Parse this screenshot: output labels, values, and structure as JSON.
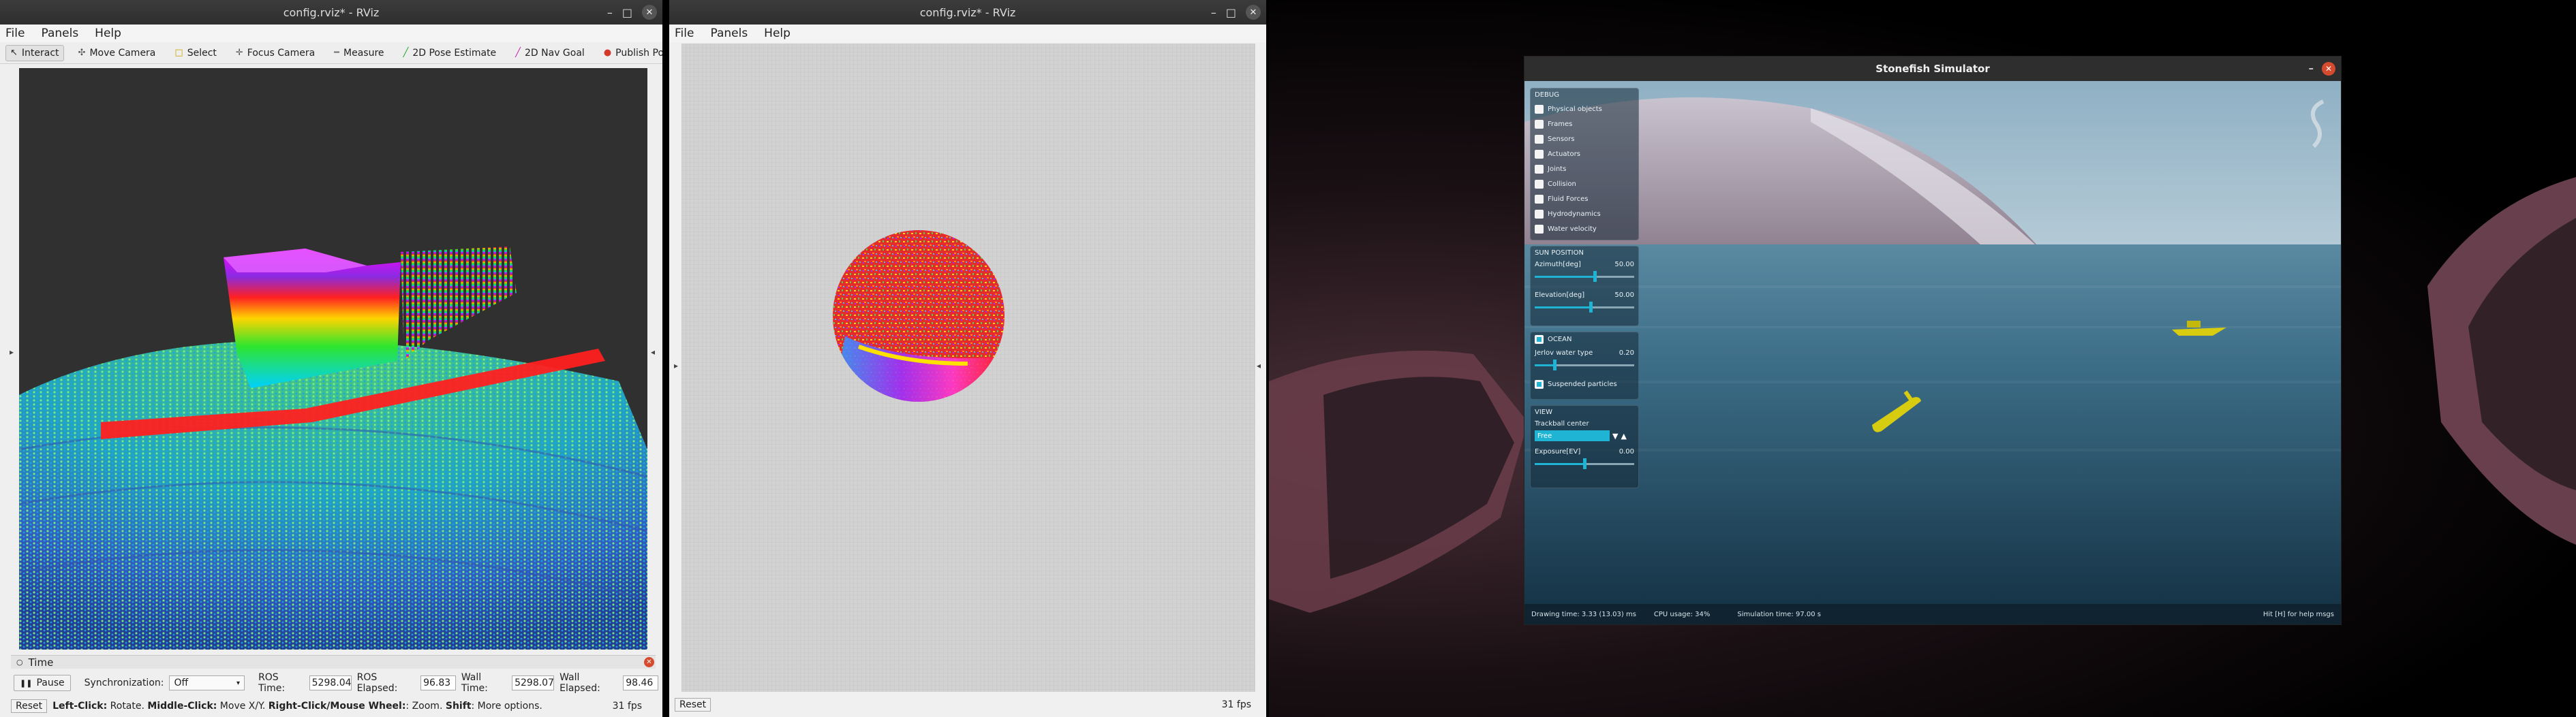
{
  "rviz1": {
    "title": "config.rviz* - RViz",
    "menu": [
      "File",
      "Panels",
      "Help"
    ],
    "tools": [
      {
        "label": "Interact",
        "icon": "cursor-icon",
        "icon_glyph": "↖",
        "icon_color": "#333333",
        "active": true
      },
      {
        "label": "Move Camera",
        "icon": "move-camera-icon",
        "icon_glyph": "✣",
        "icon_color": "#555555",
        "active": false
      },
      {
        "label": "Select",
        "icon": "select-icon",
        "icon_glyph": "□",
        "icon_color": "#c9a400",
        "active": false
      },
      {
        "label": "Focus Camera",
        "icon": "focus-camera-icon",
        "icon_glyph": "✛",
        "icon_color": "#555555",
        "active": false
      },
      {
        "label": "Measure",
        "icon": "ruler-icon",
        "icon_glyph": "━",
        "icon_color": "#777777",
        "active": false
      },
      {
        "label": "2D Pose Estimate",
        "icon": "pose-estimate-icon",
        "icon_glyph": "╱",
        "icon_color": "#2aa52a",
        "active": false
      },
      {
        "label": "2D Nav Goal",
        "icon": "nav-goal-icon",
        "icon_glyph": "╱",
        "icon_color": "#cc22aa",
        "active": false
      },
      {
        "label": "Publish Point",
        "icon": "map-pin-icon",
        "icon_glyph": "●",
        "icon_color": "#d33a2a",
        "active": false
      }
    ],
    "toolbar_extra": {
      "add": "+",
      "remove": "−",
      "more": "»"
    },
    "time_panel": {
      "header": "Time",
      "pause_label": "Pause",
      "sync_label": "Synchronization:",
      "sync_value": "Off",
      "ros_time_label": "ROS Time:",
      "ros_time_value": "5298.04",
      "ros_elapsed_label": "ROS Elapsed:",
      "ros_elapsed_value": "96.83",
      "wall_time_label": "Wall Time:",
      "wall_time_value": "5298.07",
      "wall_elapsed_label": "Wall Elapsed:",
      "wall_elapsed_value": "98.46"
    },
    "status": {
      "reset": "Reset",
      "left_key": "Left-Click:",
      "left_text": " Rotate. ",
      "middle_key": "Middle-Click:",
      "middle_text": " Move X/Y. ",
      "right_key": "Right-Click/Mouse Wheel:",
      "right_text": ": Zoom. ",
      "shift_key": "Shift",
      "shift_text": ": More options.",
      "fps": "31 fps"
    }
  },
  "rviz2": {
    "title": "config.rviz* - RViz",
    "menu": [
      "File",
      "Panels",
      "Help"
    ],
    "status": {
      "reset": "Reset",
      "fps": "31 fps"
    }
  },
  "stonefish": {
    "title": "Stonefish Simulator",
    "debug": {
      "header": "DEBUG",
      "items": [
        "Physical objects",
        "Frames",
        "Sensors",
        "Actuators",
        "Joints",
        "Collision",
        "Fluid Forces",
        "Hydrodynamics",
        "Water velocity"
      ]
    },
    "sun": {
      "header": "SUN POSITION",
      "azimuth_label": "Azimuth[deg]",
      "azimuth_value": "50.00",
      "azimuth_level": 0.6,
      "elevation_label": "Elevation[deg]",
      "elevation_value": "50.00",
      "elevation_level": 0.56
    },
    "ocean": {
      "header": "OCEAN",
      "checked": true,
      "water_label": "Jerlov water type",
      "water_value": "0.20",
      "water_level": 0.2,
      "particles_label": "Suspended particles",
      "particles_checked": true
    },
    "view": {
      "header": "VIEW",
      "trackball_label": "Trackball center",
      "trackball_value": "Free",
      "exposure_label": "Exposure[EV]",
      "exposure_value": "0.00",
      "exposure_level": 0.5
    },
    "status": {
      "drawing": "Drawing time: 3.33 (13.03) ms",
      "cpu": "CPU usage: 34%",
      "sim_time": "Simulation time: 97.00 s",
      "hint": "Hit [H] for help msgs"
    }
  },
  "colors": {
    "accent_cyan": "#1fb4d3",
    "ocean_dark": "#1b3a4d",
    "close_red": "#d64a2e",
    "viewport_dark": "#303030"
  }
}
